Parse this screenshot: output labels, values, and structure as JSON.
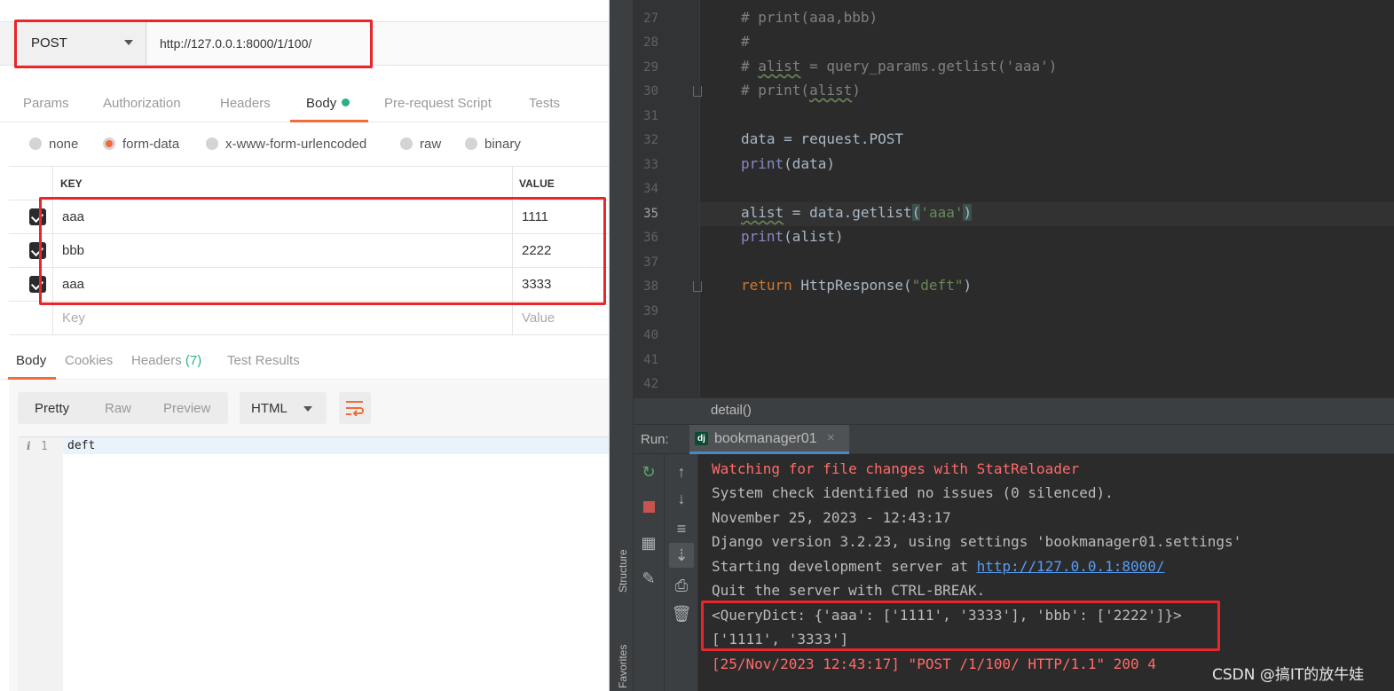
{
  "postman": {
    "method": "POST",
    "url": "http://127.0.0.1:8000/1/100/",
    "request_tabs": [
      "Params",
      "Authorization",
      "Headers",
      "Body",
      "Pre-request Script",
      "Tests"
    ],
    "active_request_tab": "Body",
    "body_modes": [
      "none",
      "form-data",
      "x-www-form-urlencoded",
      "raw",
      "binary"
    ],
    "selected_body_mode": "form-data",
    "table": {
      "headers": {
        "key": "KEY",
        "value": "VALUE"
      },
      "rows": [
        {
          "checked": true,
          "key": "aaa",
          "value": "1111"
        },
        {
          "checked": true,
          "key": "bbb",
          "value": "2222"
        },
        {
          "checked": true,
          "key": "aaa",
          "value": "3333"
        }
      ],
      "key_placeholder": "Key",
      "value_placeholder": "Value"
    },
    "response_tabs": {
      "body": "Body",
      "cookies": "Cookies",
      "headers": "Headers",
      "headers_count": "(7)",
      "test_results": "Test Results"
    },
    "view_modes": [
      "Pretty",
      "Raw",
      "Preview"
    ],
    "active_view_mode": "Pretty",
    "format": "HTML",
    "response_line_number": "1",
    "response_body": "deft"
  },
  "ide": {
    "line_numbers": [
      "27",
      "28",
      "29",
      "30",
      "31",
      "32",
      "33",
      "34",
      "35",
      "36",
      "37",
      "38",
      "39",
      "40",
      "41",
      "42"
    ],
    "current_line": "35",
    "code": {
      "l27": "# print(aaa,bbb)",
      "l28": "#",
      "l29_a": "# ",
      "l29_b": "alist",
      "l29_c": " = query_params.getlist('aaa')",
      "l30_a": "# print(",
      "l30_b": "alist",
      "l30_c": ")",
      "l32": "data = request.POST",
      "l33_fn": "print",
      "l33_rest": "(data)",
      "l35_a": "alist",
      "l35_b": " = data.getlist",
      "l35_c": "(",
      "l35_d": "'aaa'",
      "l35_e": ")",
      "l36_fn": "print",
      "l36_rest": "(alist)",
      "l38_kw": "return",
      "l38_b": " HttpResponse(",
      "l38_str": "\"deft\"",
      "l38_c": ")"
    },
    "breadcrumb": "detail()",
    "run_label": "Run:",
    "run_tab": "bookmanager01",
    "side_labels": {
      "structure": "Structure",
      "favorites": "Favorites"
    },
    "console": {
      "l1": "Watching for file changes with StatReloader",
      "l2": "System check identified no issues (0 silenced).",
      "l3": "November 25, 2023 - 12:43:17",
      "l4": "Django version 3.2.23, using settings 'bookmanager01.settings'",
      "l5_a": "Starting development server at ",
      "l5_link": "http://127.0.0.1:8000/",
      "l6": "Quit the server with CTRL-BREAK.",
      "l7": "<QueryDict: {'aaa': ['1111', '3333'], 'bbb': ['2222']}>",
      "l8": "['1111', '3333']",
      "l9": "[25/Nov/2023 12:43:17] \"POST /1/100/ HTTP/1.1\" 200 4"
    }
  },
  "watermark": "CSDN @搞IT的放牛娃",
  "colors": {
    "accent": "#f26b3a",
    "success": "#26b47f",
    "highlight": "#e8262b"
  }
}
